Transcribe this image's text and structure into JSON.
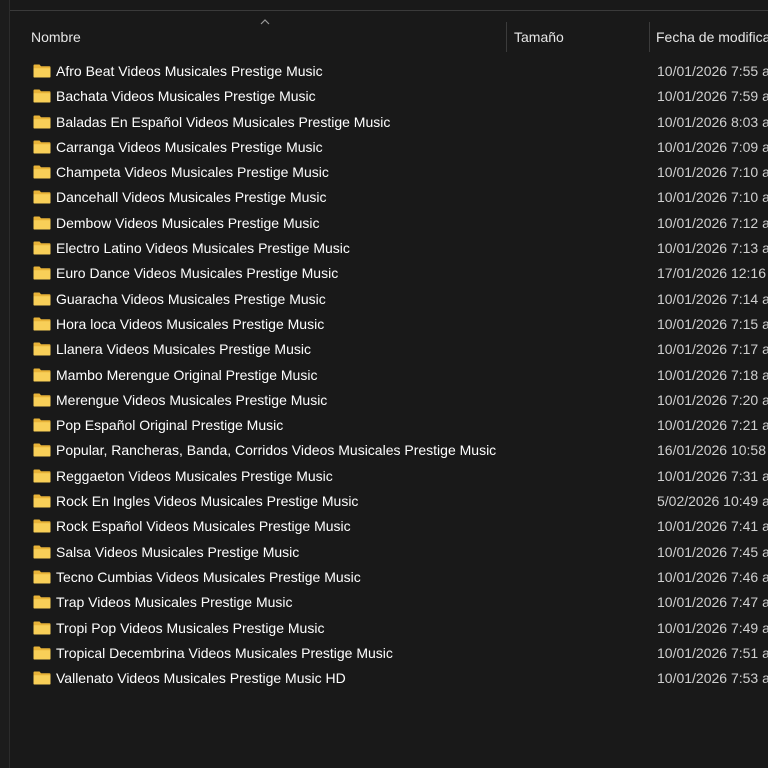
{
  "header": {
    "name_label": "Nombre",
    "size_label": "Tamaño",
    "date_label": "Fecha de modifica",
    "sort_icon": "chevron-up-icon"
  },
  "colors": {
    "background": "#191919",
    "folder": "#f4c542",
    "text": "#ffffff",
    "date_text": "#d0d0d0"
  },
  "files": [
    {
      "name": "Afro Beat Videos Musicales Prestige Music",
      "date": "10/01/2026 7:55 a"
    },
    {
      "name": "Bachata Videos Musicales Prestige Music",
      "date": "10/01/2026 7:59 a"
    },
    {
      "name": "Baladas En Español Videos Musicales Prestige Music",
      "date": "10/01/2026 8:03 a"
    },
    {
      "name": "Carranga Videos Musicales Prestige Music",
      "date": "10/01/2026 7:09 a"
    },
    {
      "name": "Champeta Videos Musicales Prestige Music",
      "date": "10/01/2026 7:10 a"
    },
    {
      "name": "Dancehall Videos Musicales Prestige Music",
      "date": "10/01/2026 7:10 a"
    },
    {
      "name": "Dembow Videos Musicales Prestige Music",
      "date": "10/01/2026 7:12 a"
    },
    {
      "name": "Electro Latino Videos Musicales Prestige Music",
      "date": "10/01/2026 7:13 a"
    },
    {
      "name": "Euro Dance Videos Musicales Prestige Music",
      "date": "17/01/2026 12:16"
    },
    {
      "name": "Guaracha Videos Musicales Prestige Music",
      "date": "10/01/2026 7:14 a"
    },
    {
      "name": "Hora loca Videos Musicales Prestige Music",
      "date": "10/01/2026 7:15 a"
    },
    {
      "name": "Llanera Videos Musicales Prestige Music",
      "date": "10/01/2026 7:17 a"
    },
    {
      "name": "Mambo Merengue Original Prestige Music",
      "date": "10/01/2026 7:18 a"
    },
    {
      "name": "Merengue Videos Musicales Prestige Music",
      "date": "10/01/2026 7:20 a"
    },
    {
      "name": "Pop Español Original Prestige Music",
      "date": "10/01/2026 7:21 a"
    },
    {
      "name": "Popular, Rancheras, Banda, Corridos Videos Musicales Prestige Music",
      "date": "16/01/2026 10:58"
    },
    {
      "name": "Reggaeton Videos Musicales Prestige Music",
      "date": "10/01/2026 7:31 a"
    },
    {
      "name": "Rock En Ingles Videos Musicales Prestige Music",
      "date": "5/02/2026 10:49 a"
    },
    {
      "name": "Rock Español Videos Musicales Prestige Music",
      "date": "10/01/2026 7:41 a"
    },
    {
      "name": "Salsa Videos Musicales Prestige Music",
      "date": "10/01/2026 7:45 a"
    },
    {
      "name": "Tecno Cumbias Videos Musicales Prestige Music",
      "date": "10/01/2026 7:46 a"
    },
    {
      "name": "Trap Videos Musicales Prestige Music",
      "date": "10/01/2026 7:47 a"
    },
    {
      "name": "Tropi Pop Videos Musicales Prestige Music",
      "date": "10/01/2026 7:49 a"
    },
    {
      "name": "Tropical Decembrina Videos Musicales Prestige Music",
      "date": "10/01/2026 7:51 a"
    },
    {
      "name": "Vallenato Videos Musicales Prestige Music HD",
      "date": "10/01/2026 7:53 a"
    }
  ]
}
